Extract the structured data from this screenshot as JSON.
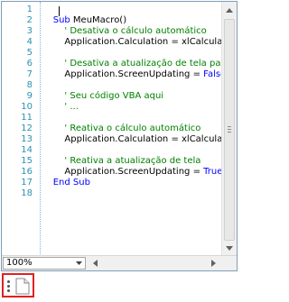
{
  "editor": {
    "line_numbers": [
      "1",
      "2",
      "3",
      "4",
      "5",
      "6",
      "7",
      "8",
      "9",
      "10",
      "11",
      "12",
      "13",
      "14",
      "15",
      "16",
      "17",
      "18"
    ],
    "lines": [
      {
        "type": "blank",
        "text": ""
      },
      {
        "type": "sub",
        "kw": "Sub",
        "text": " MeuMacro()"
      },
      {
        "type": "comment",
        "text": "    ' Desativa o cálculo automático"
      },
      {
        "type": "code",
        "text": "    Application.Calculation = xlCalculationManual"
      },
      {
        "type": "blank",
        "text": ""
      },
      {
        "type": "comment",
        "text": "    ' Desativa a atualização de tela para"
      },
      {
        "type": "code_kw",
        "text": "    Application.ScreenUpdating = ",
        "kw": "False"
      },
      {
        "type": "blank",
        "text": ""
      },
      {
        "type": "comment",
        "text": "    ' Seu código VBA aqui"
      },
      {
        "type": "comment",
        "text": "    ' ..."
      },
      {
        "type": "blank",
        "text": ""
      },
      {
        "type": "comment",
        "text": "    ' Reativa o cálculo automático"
      },
      {
        "type": "code",
        "text": "    Application.Calculation = xlCalculationAutomatic"
      },
      {
        "type": "blank",
        "text": ""
      },
      {
        "type": "comment",
        "text": "    ' Reativa a atualização de tela"
      },
      {
        "type": "code_kw",
        "text": "    Application.ScreenUpdating = ",
        "kw": "True"
      },
      {
        "type": "endsub",
        "kw": "End Sub",
        "text": ""
      },
      {
        "type": "blank",
        "text": ""
      }
    ]
  },
  "zoom": {
    "value": "100%"
  },
  "icons": {
    "zoom_dropdown": "chevron-down-icon",
    "scroll_up": "arrow-up-icon",
    "scroll_down": "arrow-down-icon",
    "scroll_left": "arrow-left-icon",
    "scroll_right": "arrow-right-icon",
    "status_menu": "more-vertical-icon",
    "document": "document-icon"
  },
  "colors": {
    "keyword": "#0000ff",
    "comment": "#008000",
    "line_number": "#2b91af",
    "highlight_border": "#e02020"
  }
}
